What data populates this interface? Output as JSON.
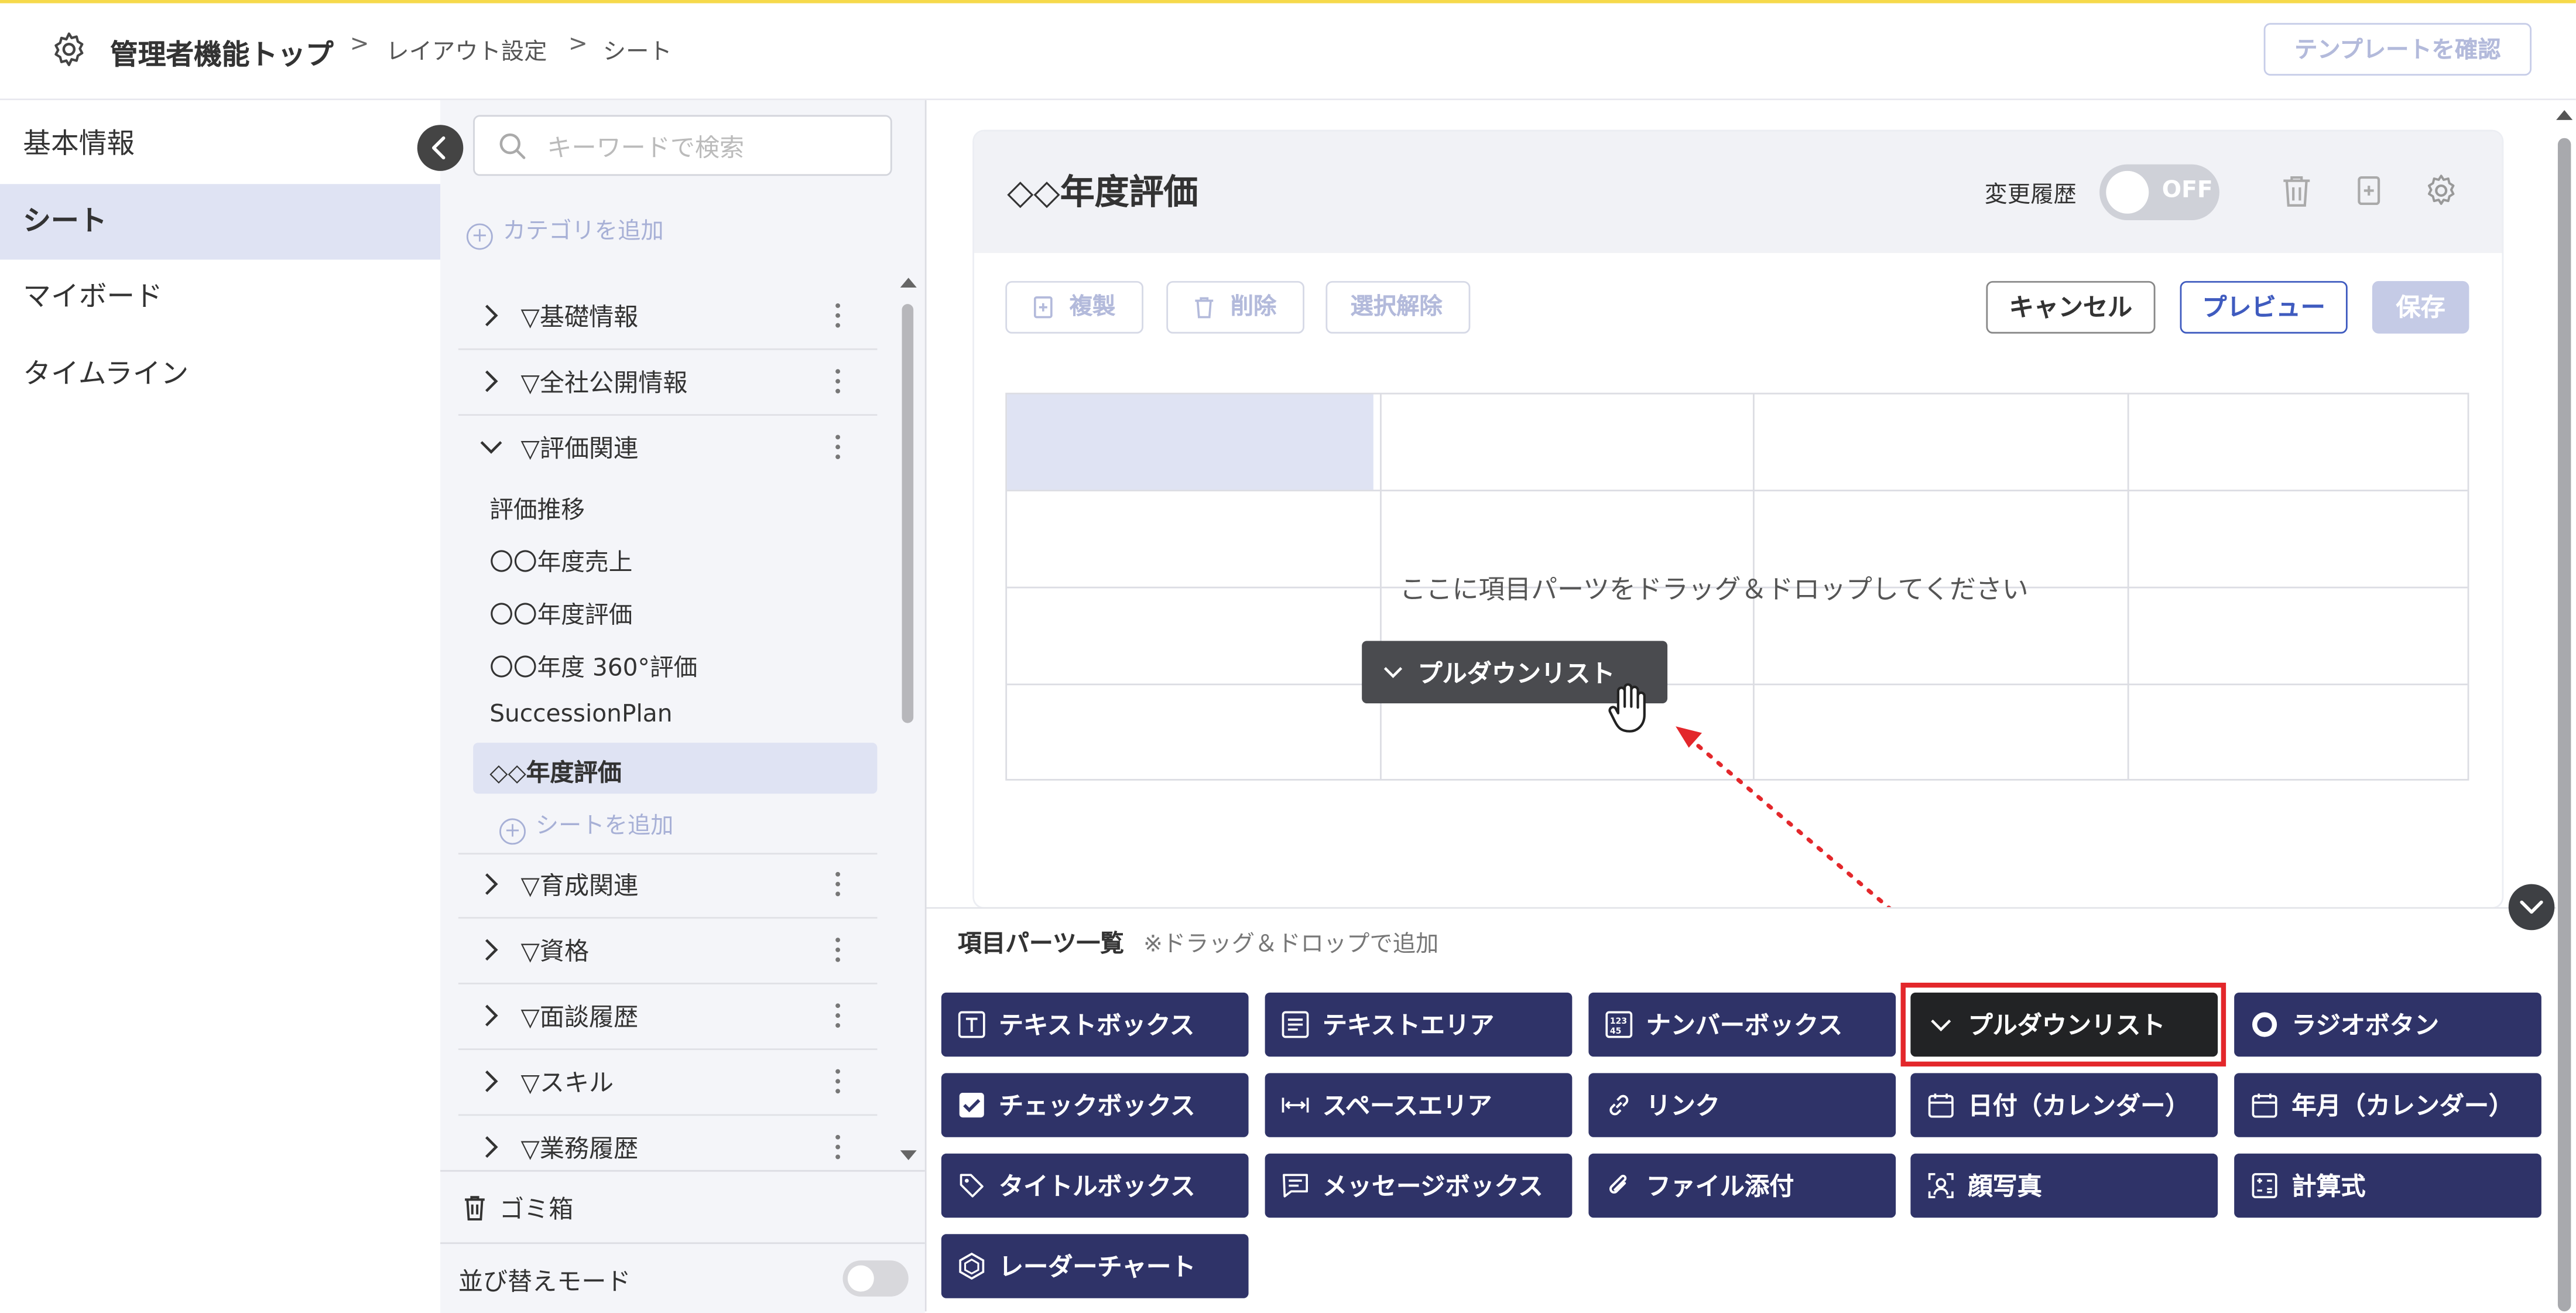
{
  "header": {
    "title": "管理者機能トップ",
    "breadcrumb": [
      "レイアウト設定",
      "シート"
    ],
    "template_button": "テンプレートを確認"
  },
  "left_nav": {
    "items": [
      {
        "label": "基本情報",
        "active": false
      },
      {
        "label": "シート",
        "active": true
      },
      {
        "label": "マイボード",
        "active": false
      },
      {
        "label": "タイムライン",
        "active": false
      }
    ]
  },
  "category_panel": {
    "search_placeholder": "キーワードで検索",
    "add_category": "カテゴリを追加",
    "categories": [
      {
        "label": "▽基礎情報",
        "expanded": false
      },
      {
        "label": "▽全社公開情報",
        "expanded": false
      },
      {
        "label": "▽評価関連",
        "expanded": true
      }
    ],
    "sheets": [
      "評価推移",
      "〇〇年度売上",
      "〇〇年度評価",
      "〇〇年度 360°評価",
      "SuccessionPlan",
      "◇◇年度評価"
    ],
    "active_sheet": "◇◇年度評価",
    "add_sheet": "シートを追加",
    "more_categories": [
      "▽育成関連",
      "▽資格",
      "▽面談履歴",
      "▽スキル",
      "▽業務履歴"
    ],
    "trash": "ゴミ箱",
    "sort_mode": "並び替えモード"
  },
  "editor": {
    "sheet_title": "◇◇年度評価",
    "history_label": "変更履歴",
    "history_toggle": "OFF",
    "toolbar": {
      "duplicate": "複製",
      "delete": "削除",
      "deselect": "選択解除",
      "cancel": "キャンセル",
      "preview": "プレビュー",
      "save": "保存"
    },
    "drop_message": "ここに項目パーツをドラッグ＆ドロップしてください",
    "dragging_chip": "プルダウンリスト"
  },
  "parts": {
    "title": "項目パーツ一覧",
    "hint": "※ドラッグ＆ドロップで追加",
    "items": [
      {
        "label": "テキストボックス",
        "icon": "textbox-icon"
      },
      {
        "label": "テキストエリア",
        "icon": "textarea-icon"
      },
      {
        "label": "ナンバーボックス",
        "icon": "number-icon"
      },
      {
        "label": "プルダウンリスト",
        "icon": "chevron-down-icon"
      },
      {
        "label": "ラジオボタン",
        "icon": "radio-icon"
      },
      {
        "label": "チェックボックス",
        "icon": "checkbox-icon"
      },
      {
        "label": "スペースエリア",
        "icon": "space-icon"
      },
      {
        "label": "リンク",
        "icon": "link-icon"
      },
      {
        "label": "日付（カレンダー）",
        "icon": "calendar-icon"
      },
      {
        "label": "年月（カレンダー）",
        "icon": "calendar-icon"
      },
      {
        "label": "タイトルボックス",
        "icon": "tag-icon"
      },
      {
        "label": "メッセージボックス",
        "icon": "message-icon"
      },
      {
        "label": "ファイル添付",
        "icon": "paperclip-icon"
      },
      {
        "label": "顔写真",
        "icon": "portrait-icon"
      },
      {
        "label": "計算式",
        "icon": "calculator-icon"
      },
      {
        "label": "レーダーチャート",
        "icon": "radar-icon"
      }
    ]
  },
  "colors": {
    "accent": "#3f5bbf",
    "part_button": "#2f3368",
    "highlight": "#e3272b",
    "active_bg": "#dfe3f3"
  }
}
